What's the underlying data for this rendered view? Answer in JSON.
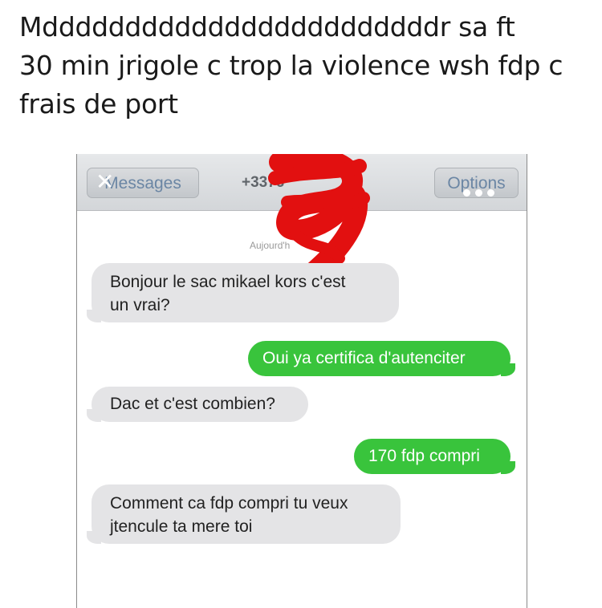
{
  "tweet": {
    "line1": "Mddddddddddddddddddddddddr sa ft",
    "line2": "30 min jrigole c trop la violence wsh fdp c",
    "line3": "frais de port"
  },
  "navbar": {
    "back_label": "Messages",
    "title": "+3376",
    "options_label": "Options",
    "bar_color": "#d3d6d9",
    "button_text_color": "#6b86a4"
  },
  "conversation": {
    "date_label": "Aujourd'h",
    "messages": [
      {
        "direction": "incoming",
        "line1": "Bonjour le sac mikael kors c'est",
        "line2": "un vrai?"
      },
      {
        "direction": "outgoing",
        "line1": "Oui ya certifica d'autenciter"
      },
      {
        "direction": "incoming",
        "line1": "Dac et c'est combien?"
      },
      {
        "direction": "outgoing",
        "line1": "170 fdp compri"
      },
      {
        "direction": "incoming",
        "line1": "Comment ca fdp compri tu veux",
        "line2": "jtencule ta mere toi"
      }
    ],
    "incoming_color": "#e4e4e6",
    "outgoing_color": "#39c43c"
  },
  "redaction": {
    "icon": "red-scribble",
    "color": "#e21010"
  }
}
